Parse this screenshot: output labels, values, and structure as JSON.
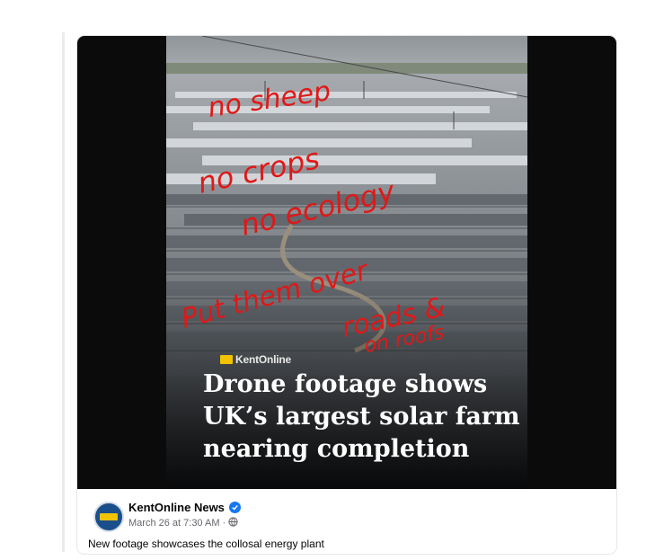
{
  "post": {
    "page_name": "KentOnline News",
    "timestamp": "March 26 at 7:30 AM",
    "separator": "·",
    "caption": "New footage showcases the collosal energy plant",
    "verified_color": "#1877f2"
  },
  "media": {
    "brand": "KentOnline",
    "headline_lines": [
      "Drone footage shows",
      "UK’s largest solar farm",
      "nearing completion"
    ],
    "handwritten_annotation": [
      "no sheep",
      "no crops",
      "no ecology",
      "Put them over",
      "roads &",
      "on roofs"
    ],
    "annotation_color": "#e01818"
  },
  "icons": {
    "verified": "verified-badge-icon",
    "audience": "globe-icon",
    "brand_mark": "kentonline-logo-icon"
  }
}
